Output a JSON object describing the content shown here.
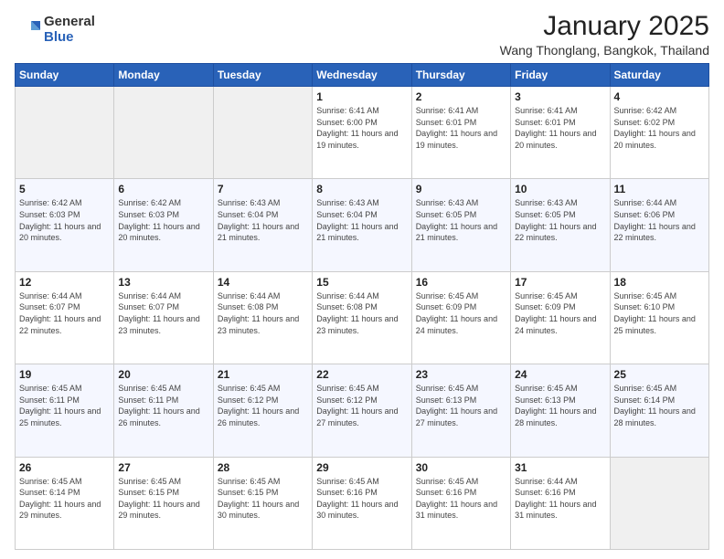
{
  "header": {
    "logo_general": "General",
    "logo_blue": "Blue",
    "main_title": "January 2025",
    "sub_title": "Wang Thonglang, Bangkok, Thailand"
  },
  "days_of_week": [
    "Sunday",
    "Monday",
    "Tuesday",
    "Wednesday",
    "Thursday",
    "Friday",
    "Saturday"
  ],
  "weeks": [
    [
      {
        "day": "",
        "info": ""
      },
      {
        "day": "",
        "info": ""
      },
      {
        "day": "",
        "info": ""
      },
      {
        "day": "1",
        "info": "Sunrise: 6:41 AM\nSunset: 6:00 PM\nDaylight: 11 hours and 19 minutes."
      },
      {
        "day": "2",
        "info": "Sunrise: 6:41 AM\nSunset: 6:01 PM\nDaylight: 11 hours and 19 minutes."
      },
      {
        "day": "3",
        "info": "Sunrise: 6:41 AM\nSunset: 6:01 PM\nDaylight: 11 hours and 20 minutes."
      },
      {
        "day": "4",
        "info": "Sunrise: 6:42 AM\nSunset: 6:02 PM\nDaylight: 11 hours and 20 minutes."
      }
    ],
    [
      {
        "day": "5",
        "info": "Sunrise: 6:42 AM\nSunset: 6:03 PM\nDaylight: 11 hours and 20 minutes."
      },
      {
        "day": "6",
        "info": "Sunrise: 6:42 AM\nSunset: 6:03 PM\nDaylight: 11 hours and 20 minutes."
      },
      {
        "day": "7",
        "info": "Sunrise: 6:43 AM\nSunset: 6:04 PM\nDaylight: 11 hours and 21 minutes."
      },
      {
        "day": "8",
        "info": "Sunrise: 6:43 AM\nSunset: 6:04 PM\nDaylight: 11 hours and 21 minutes."
      },
      {
        "day": "9",
        "info": "Sunrise: 6:43 AM\nSunset: 6:05 PM\nDaylight: 11 hours and 21 minutes."
      },
      {
        "day": "10",
        "info": "Sunrise: 6:43 AM\nSunset: 6:05 PM\nDaylight: 11 hours and 22 minutes."
      },
      {
        "day": "11",
        "info": "Sunrise: 6:44 AM\nSunset: 6:06 PM\nDaylight: 11 hours and 22 minutes."
      }
    ],
    [
      {
        "day": "12",
        "info": "Sunrise: 6:44 AM\nSunset: 6:07 PM\nDaylight: 11 hours and 22 minutes."
      },
      {
        "day": "13",
        "info": "Sunrise: 6:44 AM\nSunset: 6:07 PM\nDaylight: 11 hours and 23 minutes."
      },
      {
        "day": "14",
        "info": "Sunrise: 6:44 AM\nSunset: 6:08 PM\nDaylight: 11 hours and 23 minutes."
      },
      {
        "day": "15",
        "info": "Sunrise: 6:44 AM\nSunset: 6:08 PM\nDaylight: 11 hours and 23 minutes."
      },
      {
        "day": "16",
        "info": "Sunrise: 6:45 AM\nSunset: 6:09 PM\nDaylight: 11 hours and 24 minutes."
      },
      {
        "day": "17",
        "info": "Sunrise: 6:45 AM\nSunset: 6:09 PM\nDaylight: 11 hours and 24 minutes."
      },
      {
        "day": "18",
        "info": "Sunrise: 6:45 AM\nSunset: 6:10 PM\nDaylight: 11 hours and 25 minutes."
      }
    ],
    [
      {
        "day": "19",
        "info": "Sunrise: 6:45 AM\nSunset: 6:11 PM\nDaylight: 11 hours and 25 minutes."
      },
      {
        "day": "20",
        "info": "Sunrise: 6:45 AM\nSunset: 6:11 PM\nDaylight: 11 hours and 26 minutes."
      },
      {
        "day": "21",
        "info": "Sunrise: 6:45 AM\nSunset: 6:12 PM\nDaylight: 11 hours and 26 minutes."
      },
      {
        "day": "22",
        "info": "Sunrise: 6:45 AM\nSunset: 6:12 PM\nDaylight: 11 hours and 27 minutes."
      },
      {
        "day": "23",
        "info": "Sunrise: 6:45 AM\nSunset: 6:13 PM\nDaylight: 11 hours and 27 minutes."
      },
      {
        "day": "24",
        "info": "Sunrise: 6:45 AM\nSunset: 6:13 PM\nDaylight: 11 hours and 28 minutes."
      },
      {
        "day": "25",
        "info": "Sunrise: 6:45 AM\nSunset: 6:14 PM\nDaylight: 11 hours and 28 minutes."
      }
    ],
    [
      {
        "day": "26",
        "info": "Sunrise: 6:45 AM\nSunset: 6:14 PM\nDaylight: 11 hours and 29 minutes."
      },
      {
        "day": "27",
        "info": "Sunrise: 6:45 AM\nSunset: 6:15 PM\nDaylight: 11 hours and 29 minutes."
      },
      {
        "day": "28",
        "info": "Sunrise: 6:45 AM\nSunset: 6:15 PM\nDaylight: 11 hours and 30 minutes."
      },
      {
        "day": "29",
        "info": "Sunrise: 6:45 AM\nSunset: 6:16 PM\nDaylight: 11 hours and 30 minutes."
      },
      {
        "day": "30",
        "info": "Sunrise: 6:45 AM\nSunset: 6:16 PM\nDaylight: 11 hours and 31 minutes."
      },
      {
        "day": "31",
        "info": "Sunrise: 6:44 AM\nSunset: 6:16 PM\nDaylight: 11 hours and 31 minutes."
      },
      {
        "day": "",
        "info": ""
      }
    ]
  ]
}
